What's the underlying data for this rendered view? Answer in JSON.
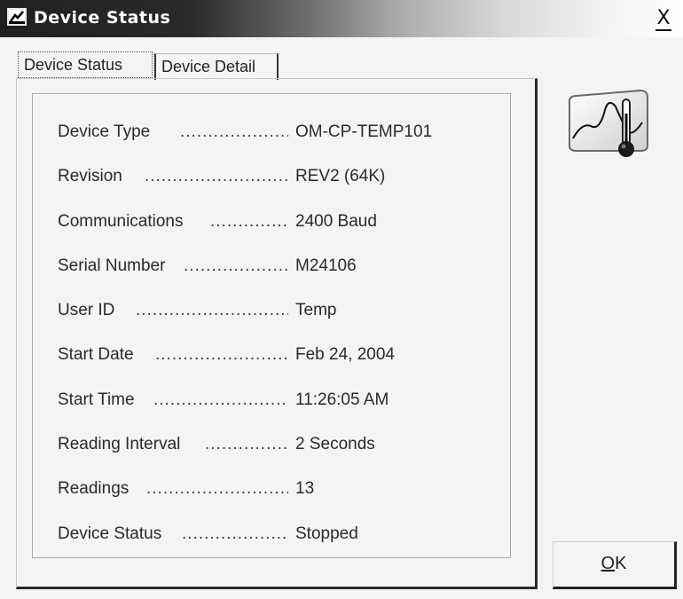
{
  "window": {
    "title": "Device Status",
    "close_glyph": "X"
  },
  "tabs": [
    {
      "label": "Device Status",
      "active": true
    },
    {
      "label": "Device Detail",
      "active": false
    }
  ],
  "fields": [
    {
      "label": "Device Type",
      "value": "OM-CP-TEMP101"
    },
    {
      "label": "Revision",
      "value": "REV2 (64K)"
    },
    {
      "label": "Communications",
      "value": "2400 Baud"
    },
    {
      "label": "Serial Number",
      "value": "M24106"
    },
    {
      "label": "User ID",
      "value": "Temp"
    },
    {
      "label": "Start Date",
      "value": "Feb 24, 2004"
    },
    {
      "label": "Start Time",
      "value": "11:26:05 AM"
    },
    {
      "label": "Reading Interval",
      "value": "2 Seconds"
    },
    {
      "label": "Readings",
      "value": "13"
    },
    {
      "label": "Device Status",
      "value": "Stopped"
    }
  ],
  "buttons": {
    "ok_accel": "O",
    "ok_rest": "K"
  },
  "icons": {
    "title": "device-status-app-icon",
    "thermometer": "thermometer-graph-icon"
  },
  "colors": {
    "titlebar_dark": "#202020",
    "titlebar_light": "#ffffff",
    "thermometer_bulb": "#1a1a1a"
  }
}
